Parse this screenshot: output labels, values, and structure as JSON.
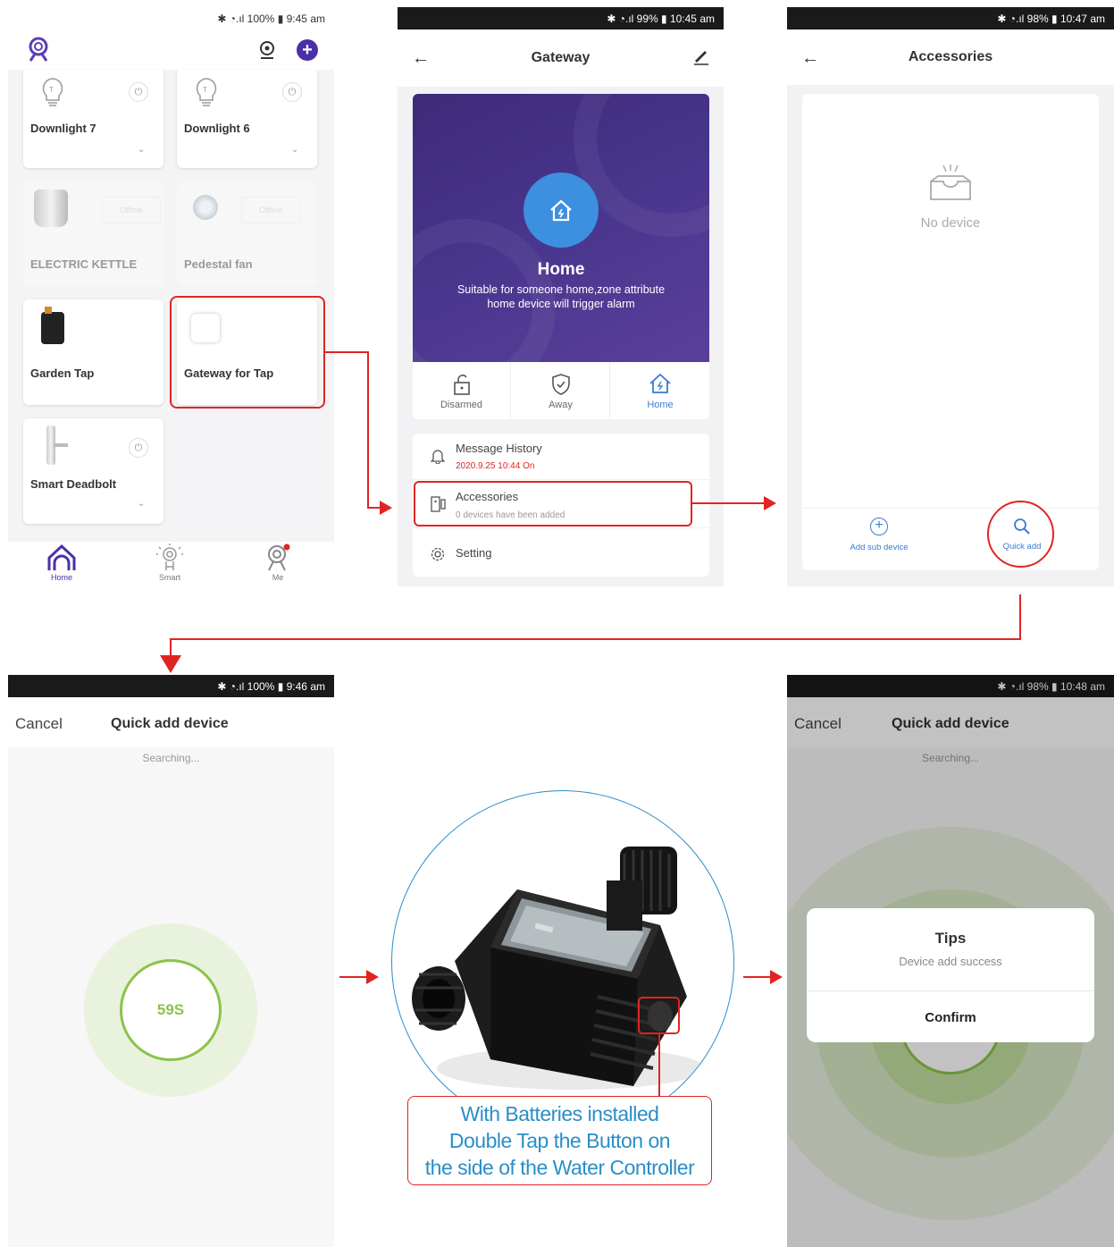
{
  "panel1": {
    "status": "✱ ◔.ıl 100% ▮ 9:45 am",
    "devices": [
      {
        "name": "Downlight 7",
        "power_icon": "power-icon"
      },
      {
        "name": "Downlight 6",
        "power_icon": "power-icon"
      },
      {
        "name": "ELECTRIC KETTLE",
        "status": "Offline"
      },
      {
        "name": "Pedestal fan",
        "status": "Offline"
      },
      {
        "name": "Garden Tap"
      },
      {
        "name": "Gateway for Tap"
      },
      {
        "name": "Smart Deadbolt",
        "power_icon": "power-icon"
      }
    ],
    "nav": [
      {
        "label": "Home",
        "icon": "home-icon"
      },
      {
        "label": "Smart",
        "icon": "smart-icon"
      },
      {
        "label": "Me",
        "icon": "me-icon"
      }
    ]
  },
  "panel2": {
    "status": "✱ ◔.ıl 99% ▮ 10:45 am",
    "title": "Gateway",
    "hero_title": "Home",
    "hero_desc_1": "Suitable for someone home,zone attribute",
    "hero_desc_2": "home device will trigger alarm",
    "modes": [
      {
        "label": "Disarmed",
        "icon": "unlock-icon"
      },
      {
        "label": "Away",
        "icon": "shield-icon"
      },
      {
        "label": "Home",
        "icon": "home-icon"
      }
    ],
    "message_history": "Message History",
    "message_sub": "2020.9.25 10:44 On",
    "accessories": "Accessories",
    "accessories_sub": "0 devices have been added",
    "setting": "Setting",
    "accent": "#3a7bd5"
  },
  "panel3": {
    "status": "✱ ◔.ıl 98% ▮ 10:47 am",
    "title": "Accessories",
    "empty": "No device",
    "add_sub": "Add sub device",
    "quick_add": "Quick add"
  },
  "panel4": {
    "status": "✱ ◔.ıl 100% ▮ 9:46 am",
    "cancel": "Cancel",
    "title": "Quick add device",
    "searching": "Searching...",
    "countdown": "59S"
  },
  "middle": {
    "caption_1": "With Batteries installed",
    "caption_2": "Double Tap the Button on",
    "caption_3": "the side of the Water Controller"
  },
  "panel5": {
    "status": "✱ ◔.ıl 98% ▮ 10:48 am",
    "cancel": "Cancel",
    "title": "Quick add device",
    "searching": "Searching...",
    "dialog_title": "Tips",
    "dialog_msg": "Device add success",
    "confirm": "Confirm"
  },
  "colors": {
    "red": "#e02424",
    "green": "#8bc34a",
    "blue": "#2a8ec9"
  }
}
